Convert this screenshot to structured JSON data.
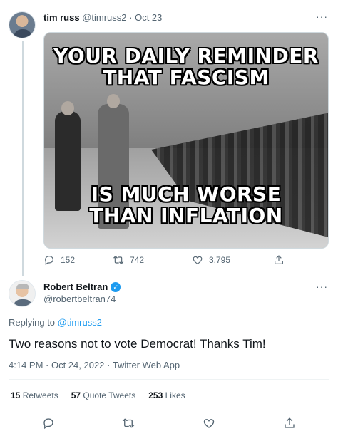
{
  "tweet": {
    "author_name": "tim russ",
    "author_handle": "@timruss2",
    "separator": " · ",
    "date": "Oct 23",
    "more": "···",
    "image": {
      "caption_top_line1": "YOUR DAILY REMINDER",
      "caption_top_line2": "THAT FASCISM",
      "caption_bottom_line1": "IS MUCH WORSE",
      "caption_bottom_line2": "THAN INFLATION"
    },
    "replies_count": "152",
    "retweets_count": "742",
    "likes_count": "3,795"
  },
  "reply": {
    "author_name": "Robert Beltran",
    "author_handle": "@robertbeltran74",
    "more": "···",
    "replying_prefix": "Replying to ",
    "replying_to": "@timruss2",
    "text": "Two reasons not to vote Democrat! Thanks Tim!",
    "timestamp": "4:14 PM · Oct 24, 2022 · Twitter Web App",
    "stats": {
      "retweets_num": "15",
      "retweets_label": " Retweets",
      "quotes_num": "57",
      "quotes_label": " Quote Tweets",
      "likes_num": "253",
      "likes_label": " Likes"
    }
  },
  "icons": [
    "reply-icon",
    "retweet-icon",
    "like-icon",
    "share-icon",
    "verified-badge-icon"
  ],
  "colors": {
    "accent": "#1d9bf0",
    "muted": "#536471",
    "text": "#0f1419",
    "divider": "#eff3f4"
  }
}
